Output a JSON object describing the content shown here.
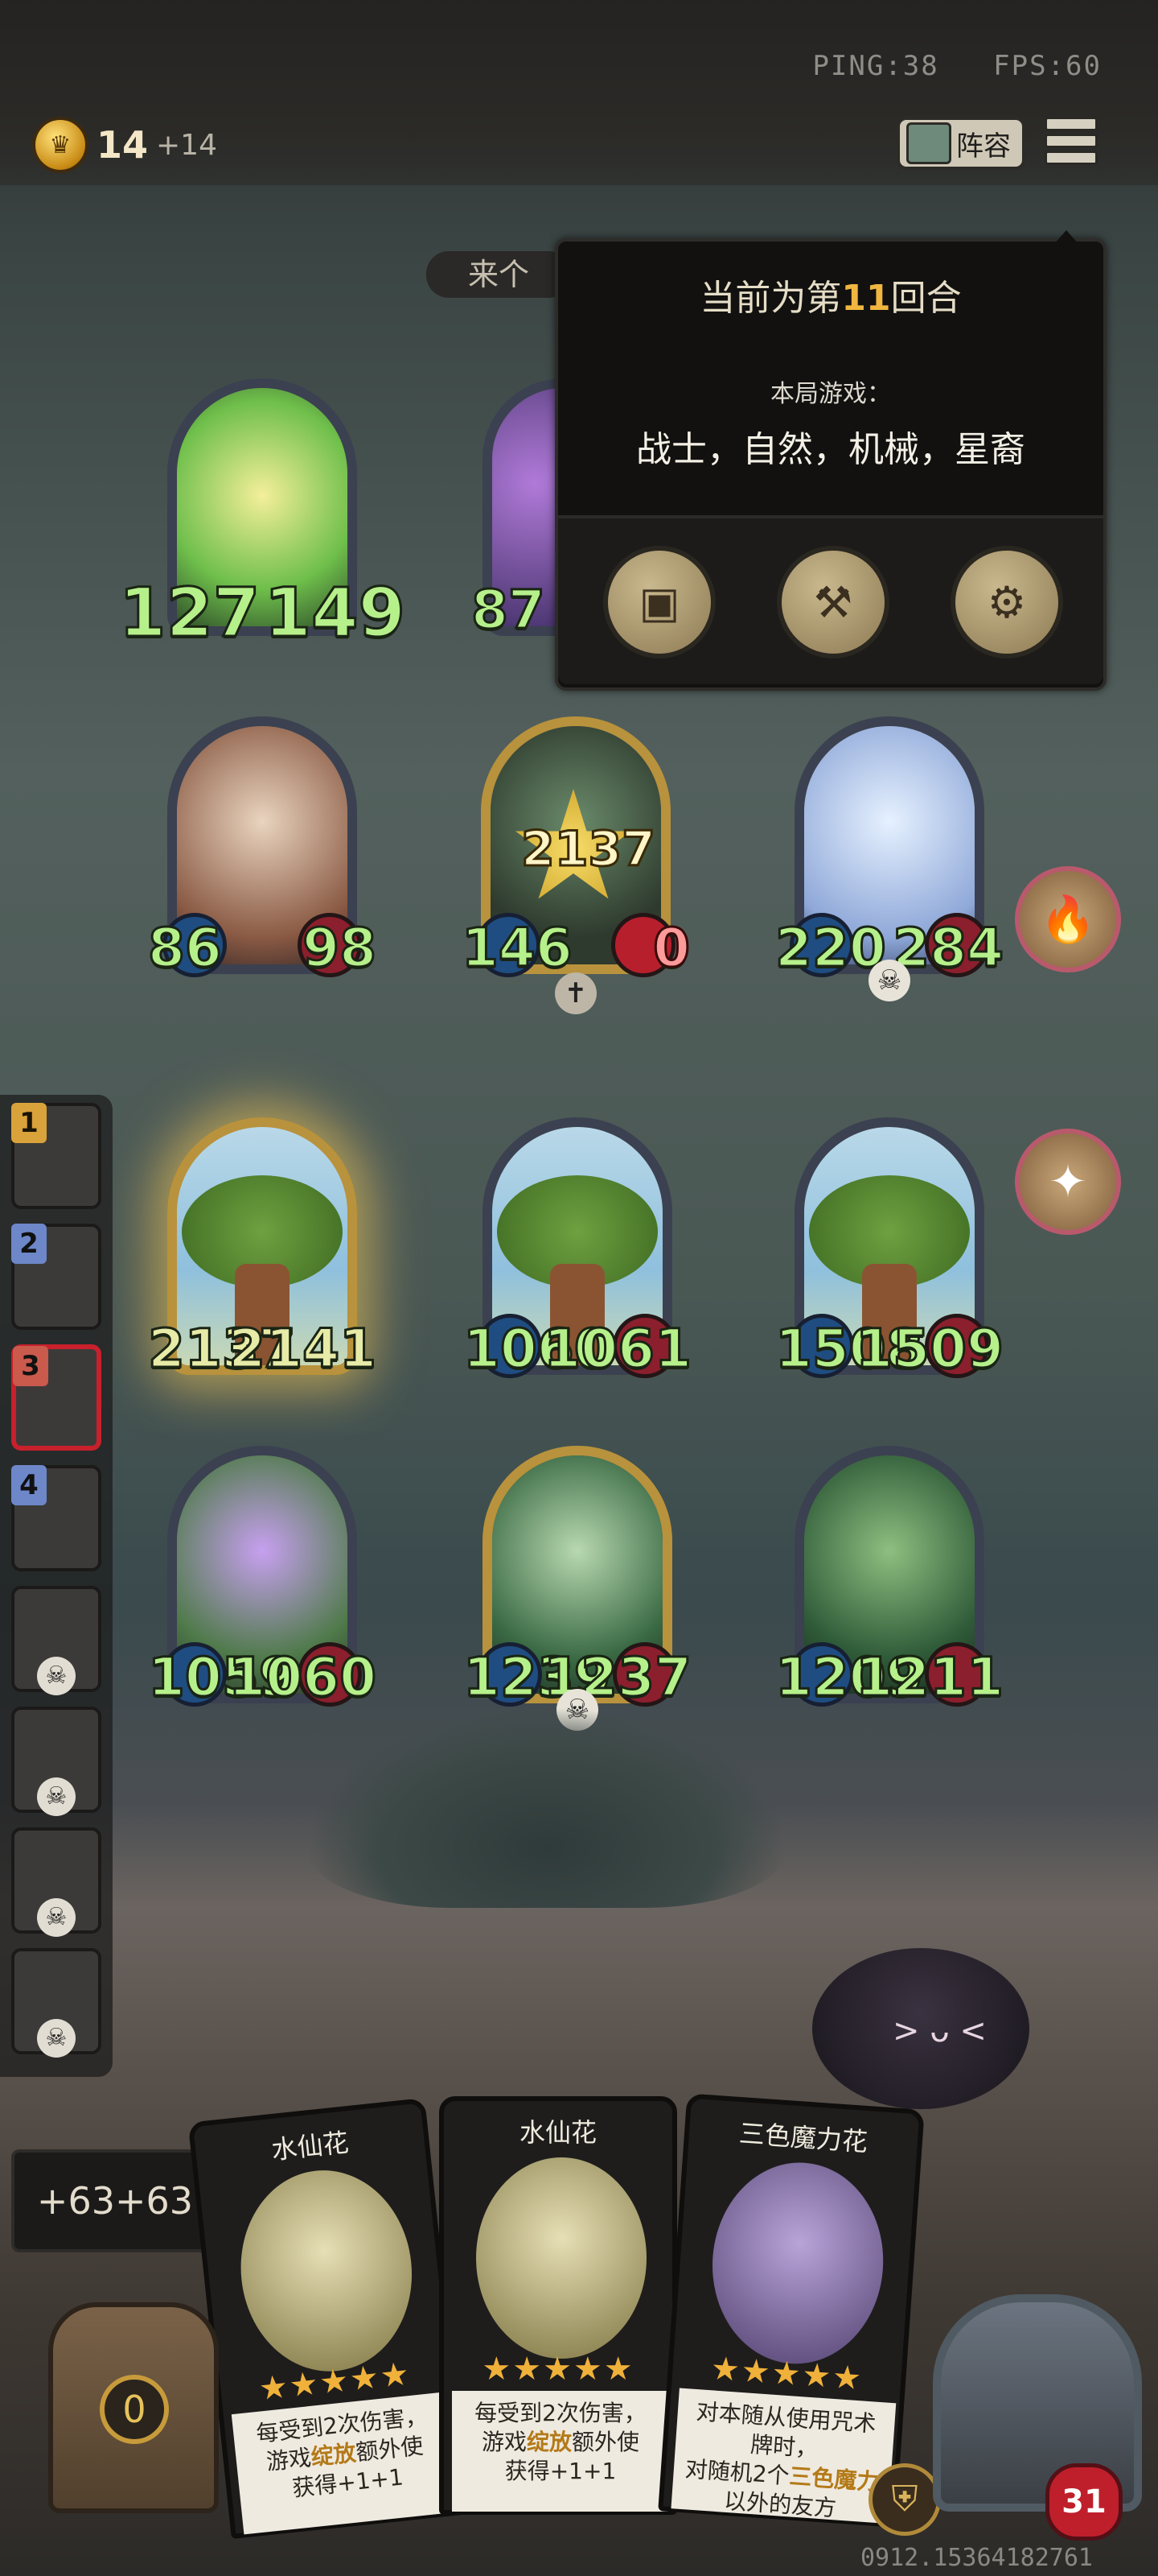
{
  "hud": {
    "ping": "PING:38",
    "fps": "FPS:60",
    "gold": "14",
    "gold_income": "+14",
    "lineup_label": "阵容"
  },
  "popup": {
    "round_prefix": "当前为第",
    "round_number": "11",
    "round_suffix": "回合",
    "game_label": "本局游戏：",
    "tribes": "战士，自然，机械，星裔",
    "buttons": [
      {
        "icon": "card-book-icon"
      },
      {
        "icon": "axe-icon"
      },
      {
        "icon": "gear-icon"
      }
    ]
  },
  "banner": {
    "text": "来个"
  },
  "board": {
    "row1": [
      {
        "attack": "127",
        "health": "149",
        "name": "green-fairy"
      },
      {
        "attack": "87",
        "health": "",
        "name": "purple-flower"
      }
    ],
    "row2": [
      {
        "attack": "86",
        "health": "98",
        "name": "maid-trumpeter"
      },
      {
        "attack": "146",
        "health": "0",
        "name": "gold-shield-minion",
        "damage": "2137"
      },
      {
        "attack": "220",
        "health": "284",
        "name": "ice-queen"
      }
    ],
    "row3": [
      {
        "attack": "2137",
        "health": "2141",
        "name": "golden-tree"
      },
      {
        "attack": "1060",
        "health": "1061",
        "name": "tree"
      },
      {
        "attack": "1508",
        "health": "1509",
        "name": "tree"
      }
    ],
    "row4": [
      {
        "attack": "1059",
        "health": "1060",
        "name": "purple-flower-dryad"
      },
      {
        "attack": "1239",
        "health": "1237",
        "name": "gold-dryad"
      },
      {
        "attack": "1209",
        "health": "1211",
        "name": "lupine-dryad"
      }
    ]
  },
  "sidebar": {
    "players": [
      {
        "rank": "1"
      },
      {
        "rank": "2"
      },
      {
        "rank": "3"
      },
      {
        "rank": "4"
      },
      {
        "rank": ""
      },
      {
        "rank": ""
      },
      {
        "rank": ""
      },
      {
        "rank": ""
      }
    ]
  },
  "bonus": "+63+63",
  "hand": [
    {
      "name": "水仙花",
      "stars": "★★★★★",
      "desc_a": "每受到2次伤害，",
      "desc_b": "游戏",
      "desc_hl": "绽放",
      "desc_c": "额外使",
      "desc_d": "获得+1+1"
    },
    {
      "name": "水仙花",
      "stars": "★★★★★",
      "desc_a": "每受到2次伤害，",
      "desc_b": "游戏",
      "desc_hl": "绽放",
      "desc_c": "额外使",
      "desc_d": "获得+1+1"
    },
    {
      "name": "三色魔力花",
      "stars": "★★★★★",
      "desc_a": "对本随从使用咒术牌时，",
      "desc_b": "对随机2个",
      "desc_hl": "三色魔力",
      "desc_c": "",
      "desc_d": "以外的友方"
    }
  ],
  "chest_count": "0",
  "hero_hp": "31",
  "build": "0912.15364182761"
}
